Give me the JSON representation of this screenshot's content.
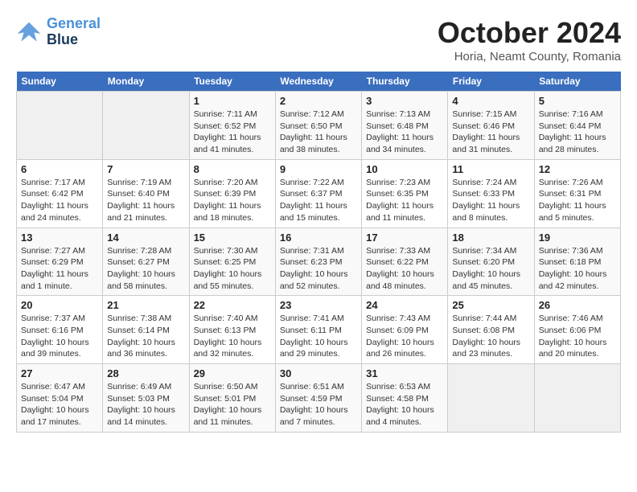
{
  "header": {
    "logo_line1": "General",
    "logo_line2": "Blue",
    "month": "October 2024",
    "location": "Horia, Neamt County, Romania"
  },
  "weekdays": [
    "Sunday",
    "Monday",
    "Tuesday",
    "Wednesday",
    "Thursday",
    "Friday",
    "Saturday"
  ],
  "weeks": [
    [
      {
        "num": "",
        "info": ""
      },
      {
        "num": "",
        "info": ""
      },
      {
        "num": "1",
        "info": "Sunrise: 7:11 AM\nSunset: 6:52 PM\nDaylight: 11 hours and 41 minutes."
      },
      {
        "num": "2",
        "info": "Sunrise: 7:12 AM\nSunset: 6:50 PM\nDaylight: 11 hours and 38 minutes."
      },
      {
        "num": "3",
        "info": "Sunrise: 7:13 AM\nSunset: 6:48 PM\nDaylight: 11 hours and 34 minutes."
      },
      {
        "num": "4",
        "info": "Sunrise: 7:15 AM\nSunset: 6:46 PM\nDaylight: 11 hours and 31 minutes."
      },
      {
        "num": "5",
        "info": "Sunrise: 7:16 AM\nSunset: 6:44 PM\nDaylight: 11 hours and 28 minutes."
      }
    ],
    [
      {
        "num": "6",
        "info": "Sunrise: 7:17 AM\nSunset: 6:42 PM\nDaylight: 11 hours and 24 minutes."
      },
      {
        "num": "7",
        "info": "Sunrise: 7:19 AM\nSunset: 6:40 PM\nDaylight: 11 hours and 21 minutes."
      },
      {
        "num": "8",
        "info": "Sunrise: 7:20 AM\nSunset: 6:39 PM\nDaylight: 11 hours and 18 minutes."
      },
      {
        "num": "9",
        "info": "Sunrise: 7:22 AM\nSunset: 6:37 PM\nDaylight: 11 hours and 15 minutes."
      },
      {
        "num": "10",
        "info": "Sunrise: 7:23 AM\nSunset: 6:35 PM\nDaylight: 11 hours and 11 minutes."
      },
      {
        "num": "11",
        "info": "Sunrise: 7:24 AM\nSunset: 6:33 PM\nDaylight: 11 hours and 8 minutes."
      },
      {
        "num": "12",
        "info": "Sunrise: 7:26 AM\nSunset: 6:31 PM\nDaylight: 11 hours and 5 minutes."
      }
    ],
    [
      {
        "num": "13",
        "info": "Sunrise: 7:27 AM\nSunset: 6:29 PM\nDaylight: 11 hours and 1 minute."
      },
      {
        "num": "14",
        "info": "Sunrise: 7:28 AM\nSunset: 6:27 PM\nDaylight: 10 hours and 58 minutes."
      },
      {
        "num": "15",
        "info": "Sunrise: 7:30 AM\nSunset: 6:25 PM\nDaylight: 10 hours and 55 minutes."
      },
      {
        "num": "16",
        "info": "Sunrise: 7:31 AM\nSunset: 6:23 PM\nDaylight: 10 hours and 52 minutes."
      },
      {
        "num": "17",
        "info": "Sunrise: 7:33 AM\nSunset: 6:22 PM\nDaylight: 10 hours and 48 minutes."
      },
      {
        "num": "18",
        "info": "Sunrise: 7:34 AM\nSunset: 6:20 PM\nDaylight: 10 hours and 45 minutes."
      },
      {
        "num": "19",
        "info": "Sunrise: 7:36 AM\nSunset: 6:18 PM\nDaylight: 10 hours and 42 minutes."
      }
    ],
    [
      {
        "num": "20",
        "info": "Sunrise: 7:37 AM\nSunset: 6:16 PM\nDaylight: 10 hours and 39 minutes."
      },
      {
        "num": "21",
        "info": "Sunrise: 7:38 AM\nSunset: 6:14 PM\nDaylight: 10 hours and 36 minutes."
      },
      {
        "num": "22",
        "info": "Sunrise: 7:40 AM\nSunset: 6:13 PM\nDaylight: 10 hours and 32 minutes."
      },
      {
        "num": "23",
        "info": "Sunrise: 7:41 AM\nSunset: 6:11 PM\nDaylight: 10 hours and 29 minutes."
      },
      {
        "num": "24",
        "info": "Sunrise: 7:43 AM\nSunset: 6:09 PM\nDaylight: 10 hours and 26 minutes."
      },
      {
        "num": "25",
        "info": "Sunrise: 7:44 AM\nSunset: 6:08 PM\nDaylight: 10 hours and 23 minutes."
      },
      {
        "num": "26",
        "info": "Sunrise: 7:46 AM\nSunset: 6:06 PM\nDaylight: 10 hours and 20 minutes."
      }
    ],
    [
      {
        "num": "27",
        "info": "Sunrise: 6:47 AM\nSunset: 5:04 PM\nDaylight: 10 hours and 17 minutes."
      },
      {
        "num": "28",
        "info": "Sunrise: 6:49 AM\nSunset: 5:03 PM\nDaylight: 10 hours and 14 minutes."
      },
      {
        "num": "29",
        "info": "Sunrise: 6:50 AM\nSunset: 5:01 PM\nDaylight: 10 hours and 11 minutes."
      },
      {
        "num": "30",
        "info": "Sunrise: 6:51 AM\nSunset: 4:59 PM\nDaylight: 10 hours and 7 minutes."
      },
      {
        "num": "31",
        "info": "Sunrise: 6:53 AM\nSunset: 4:58 PM\nDaylight: 10 hours and 4 minutes."
      },
      {
        "num": "",
        "info": ""
      },
      {
        "num": "",
        "info": ""
      }
    ]
  ]
}
